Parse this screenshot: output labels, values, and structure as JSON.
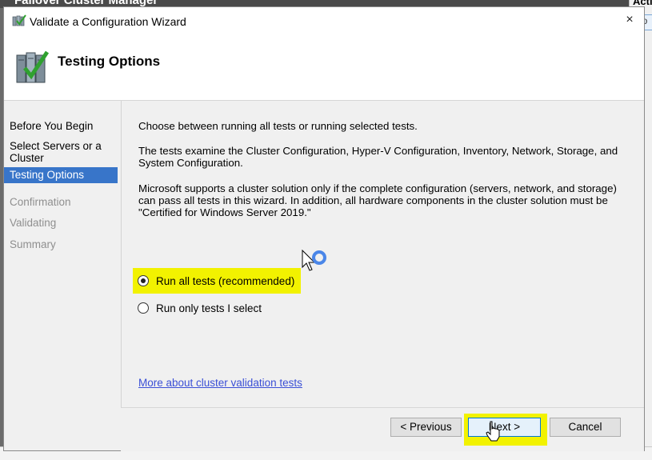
{
  "background_app": {
    "title": "Failover Cluster Manager",
    "right_label": "Acti",
    "right_box": "lo"
  },
  "dialog": {
    "title": "Validate a Configuration Wizard",
    "close": "×"
  },
  "header": {
    "title": "Testing Options"
  },
  "sidebar": {
    "items": [
      {
        "label": "Before You Begin",
        "state": "normal"
      },
      {
        "label": "Select Servers or a Cluster",
        "state": "normal"
      },
      {
        "label": "Testing Options",
        "state": "active"
      },
      {
        "label": "Confirmation",
        "state": "disabled"
      },
      {
        "label": "Validating",
        "state": "disabled"
      },
      {
        "label": "Summary",
        "state": "disabled"
      }
    ]
  },
  "content": {
    "intro": "Choose between running all tests or running selected tests.",
    "description": "The tests examine the Cluster Configuration, Hyper-V Configuration, Inventory, Network, Storage, and System Configuration.",
    "support_note": "Microsoft supports a cluster solution only if the complete configuration (servers, network, and storage) can pass all tests in this wizard. In addition, all hardware components in the cluster solution must be \"Certified for Windows Server 2019.\"",
    "options": [
      {
        "label": "Run all tests (recommended)",
        "selected": true
      },
      {
        "label": "Run only tests I select",
        "selected": false
      }
    ],
    "link": "More about cluster validation tests"
  },
  "buttons": {
    "previous": "< Previous",
    "next": "Next >",
    "cancel": "Cancel"
  },
  "colors": {
    "highlight": "#f2f200",
    "active_nav": "#3875c9",
    "link": "#3a4fd6"
  }
}
